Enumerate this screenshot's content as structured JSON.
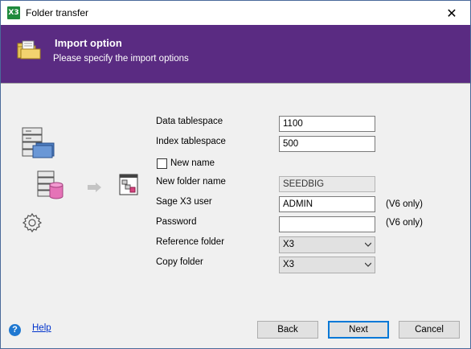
{
  "window": {
    "title": "Folder transfer",
    "app_icon_text": "X3"
  },
  "header": {
    "title": "Import option",
    "subtitle": "Please specify the import options",
    "background": "#5a2b82"
  },
  "form": {
    "data_tablespace_label": "Data tablespace",
    "data_tablespace_value": "1100",
    "index_tablespace_label": "Index tablespace",
    "index_tablespace_value": "500",
    "new_name_label": "New name",
    "new_name_checked": false,
    "new_folder_name_label": "New folder name",
    "new_folder_name_value": "SEEDBIG",
    "sage_user_label": "Sage X3 user",
    "sage_user_value": "ADMIN",
    "sage_user_hint": "(V6 only)",
    "password_label": "Password",
    "password_value": "",
    "password_hint": "(V6 only)",
    "reference_folder_label": "Reference folder",
    "reference_folder_value": "X3",
    "copy_folder_label": "Copy folder",
    "copy_folder_value": "X3"
  },
  "footer": {
    "help_icon": "?",
    "help_label": "Help",
    "back_label": "Back",
    "next_label": "Next",
    "cancel_label": "Cancel"
  },
  "icons": [
    "folder-transfer-icon",
    "server-folder-icon",
    "database-icon",
    "arrow-right-icon",
    "x3-window-icon",
    "gear-icon",
    "help-icon",
    "close-icon",
    "chevron-down-icon"
  ]
}
